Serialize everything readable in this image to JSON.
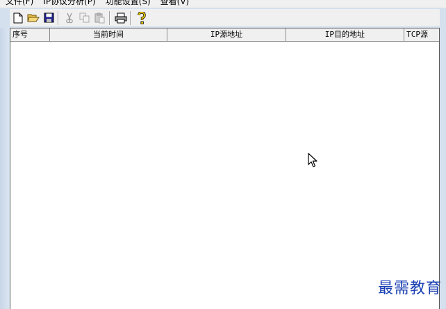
{
  "menu": {
    "items": [
      {
        "label": "文件(F)"
      },
      {
        "label": "IP协议分析(P)"
      },
      {
        "label": "功能设置(S)"
      },
      {
        "label": "查看(V)"
      }
    ]
  },
  "toolbar": {
    "buttons": [
      {
        "icon": "new-file-icon",
        "enabled": true
      },
      {
        "icon": "open-folder-icon",
        "enabled": true
      },
      {
        "icon": "save-icon",
        "enabled": true
      },
      {
        "icon": "cut-icon",
        "enabled": false
      },
      {
        "icon": "copy-icon",
        "enabled": false
      },
      {
        "icon": "paste-icon",
        "enabled": false
      },
      {
        "icon": "print-icon",
        "enabled": true
      },
      {
        "icon": "help-icon",
        "enabled": true
      }
    ]
  },
  "table": {
    "columns": [
      "序号",
      "当前时间",
      "IP源地址",
      "IP目的地址",
      "TCP源"
    ],
    "rows": []
  },
  "watermark": "最需教育",
  "colors": {
    "window_frame": "#d4e0ee",
    "toolbar_bg": "#f0f0f0",
    "watermark": "#1a3fb3"
  }
}
